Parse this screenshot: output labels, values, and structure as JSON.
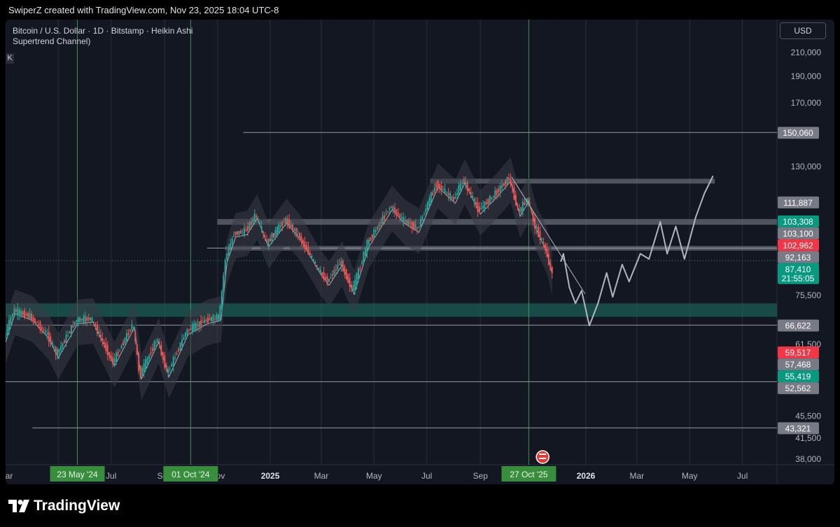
{
  "header": {
    "attribution": "SwiperZ created with TradingView.com, Nov 23, 2025 18:04 UTC-8"
  },
  "legend": {
    "line1": "Bitcoin / U.S. Dollar · 1D · Bitstamp · Heikin Ashi",
    "line2": "Supertrend Channel)",
    "k_label": "K"
  },
  "currency_button": "USD",
  "footer": {
    "brand": "TradingView"
  },
  "colors": {
    "bg": "#131722",
    "grid": "#2a2e39",
    "up": "#26a69a",
    "down": "#ef5350",
    "event_line": "#4caf50",
    "zone": "#1b5e54"
  },
  "chart_data": {
    "type": "candlestick",
    "symbol": "Bitcoin / U.S. Dollar",
    "interval": "1D",
    "exchange": "Bitstamp",
    "style": "Heikin Ashi",
    "ylim": [
      38000,
      210000
    ],
    "y_scale": "log",
    "y_ticks": [
      "210,000",
      "190,000",
      "170,000",
      "130,000",
      "75,500",
      "61,500",
      "45,500",
      "41,500",
      "38,000"
    ],
    "x_ticks": [
      "Mar",
      "May",
      "Jul",
      "Sep",
      "Nov",
      "2025",
      "Mar",
      "May",
      "Jul",
      "Sep",
      "2026",
      "Mar",
      "May",
      "Jul"
    ],
    "x_range": [
      "2024-03-01",
      "2026-08-10"
    ],
    "events": [
      {
        "label": "23 May '24",
        "date": "2024-05-23"
      },
      {
        "label": "01 Oct '24",
        "date": "2024-10-01"
      },
      {
        "label": "27 Oct '25",
        "date": "2025-10-27"
      }
    ],
    "price_labels": [
      {
        "text": "150,060",
        "value": 150060,
        "color": "#787b86"
      },
      {
        "text": "111,887",
        "value": 111887,
        "color": "#787b86"
      },
      {
        "text": "103,308",
        "value": 103308,
        "color": "#089981"
      },
      {
        "text": "103,100",
        "value": 103100,
        "color": "#787b86"
      },
      {
        "text": "102,962",
        "value": 102962,
        "color": "#f23645"
      },
      {
        "text": "92,163",
        "value": 92163,
        "color": "#787b86"
      },
      {
        "text": "87,410",
        "value": 87410,
        "color": "#089981",
        "sub": "21:55:05"
      },
      {
        "text": "66,622",
        "value": 66622,
        "color": "#787b86"
      },
      {
        "text": "59,517",
        "value": 59517,
        "color": "#f23645"
      },
      {
        "text": "57,468",
        "value": 57468,
        "color": "#787b86"
      },
      {
        "text": "55,419",
        "value": 55419,
        "color": "#089981"
      },
      {
        "text": "52,562",
        "value": 52562,
        "color": "#787b86"
      },
      {
        "text": "43,321",
        "value": 43321,
        "color": "#787b86"
      }
    ],
    "horizontal_levels": [
      {
        "value": 150060,
        "from": "2024-12-01"
      },
      {
        "value": 92163,
        "from": "2024-10-20"
      },
      {
        "value": 66622,
        "from": "2024-03-01"
      },
      {
        "value": 52562,
        "from": "2024-03-01"
      },
      {
        "value": 43321,
        "from": "2024-04-01"
      }
    ],
    "resistance_boxes": [
      {
        "top": 123500,
        "bottom": 121000,
        "from": "2025-07-05",
        "to": "2026-05-30"
      },
      {
        "top": 104200,
        "bottom": 101700,
        "from": "2024-11-01",
        "to": "2026-08-10"
      },
      {
        "top": 93000,
        "bottom": 91200,
        "from": "2024-11-10",
        "to": "2026-08-10"
      }
    ],
    "support_zone": {
      "top": 73000,
      "bottom": 69000,
      "from": "2024-03-01",
      "to": "2026-08-10"
    },
    "price_series": [
      [
        "2024-03-01",
        63000
      ],
      [
        "2024-03-12",
        71000
      ],
      [
        "2024-04-01",
        69000
      ],
      [
        "2024-04-20",
        64000
      ],
      [
        "2024-05-01",
        59000
      ],
      [
        "2024-05-23",
        68000
      ],
      [
        "2024-06-10",
        68500
      ],
      [
        "2024-07-05",
        57000
      ],
      [
        "2024-07-28",
        67000
      ],
      [
        "2024-08-05",
        54000
      ],
      [
        "2024-08-25",
        63000
      ],
      [
        "2024-09-06",
        54500
      ],
      [
        "2024-09-28",
        65000
      ],
      [
        "2024-10-20",
        68000
      ],
      [
        "2024-11-05",
        69000
      ],
      [
        "2024-11-12",
        88000
      ],
      [
        "2024-11-22",
        98000
      ],
      [
        "2024-12-05",
        99000
      ],
      [
        "2024-12-17",
        106000
      ],
      [
        "2024-12-30",
        94000
      ],
      [
        "2025-01-20",
        104000
      ],
      [
        "2025-02-05",
        97000
      ],
      [
        "2025-02-28",
        84000
      ],
      [
        "2025-03-10",
        80000
      ],
      [
        "2025-03-25",
        87000
      ],
      [
        "2025-04-08",
        77000
      ],
      [
        "2025-04-25",
        94000
      ],
      [
        "2025-05-22",
        110000
      ],
      [
        "2025-06-05",
        104000
      ],
      [
        "2025-06-22",
        100000
      ],
      [
        "2025-07-14",
        121000
      ],
      [
        "2025-08-03",
        113000
      ],
      [
        "2025-08-14",
        123000
      ],
      [
        "2025-09-01",
        108000
      ],
      [
        "2025-09-20",
        116000
      ],
      [
        "2025-10-06",
        124000
      ],
      [
        "2025-10-17",
        107000
      ],
      [
        "2025-10-27",
        114000
      ],
      [
        "2025-11-05",
        101000
      ],
      [
        "2025-11-17",
        92000
      ],
      [
        "2025-11-23",
        84000
      ]
    ],
    "projection": [
      [
        "2025-12-03",
        87000
      ],
      [
        "2025-12-06",
        90000
      ],
      [
        "2025-12-13",
        78000
      ],
      [
        "2025-12-20",
        73000
      ],
      [
        "2025-12-27",
        77000
      ],
      [
        "2026-01-05",
        66500
      ],
      [
        "2026-01-15",
        73000
      ],
      [
        "2026-01-25",
        83000
      ],
      [
        "2026-02-01",
        75000
      ],
      [
        "2026-02-12",
        86000
      ],
      [
        "2026-02-20",
        80000
      ],
      [
        "2026-03-05",
        90000
      ],
      [
        "2026-03-15",
        88000
      ],
      [
        "2026-03-28",
        103000
      ],
      [
        "2026-04-05",
        90000
      ],
      [
        "2026-04-15",
        101000
      ],
      [
        "2026-04-25",
        88000
      ],
      [
        "2026-05-08",
        105000
      ],
      [
        "2026-05-18",
        116000
      ],
      [
        "2026-05-28",
        125000
      ]
    ],
    "trendline": [
      [
        "2025-10-07",
        124500
      ],
      [
        "2025-12-31",
        76000
      ]
    ]
  }
}
